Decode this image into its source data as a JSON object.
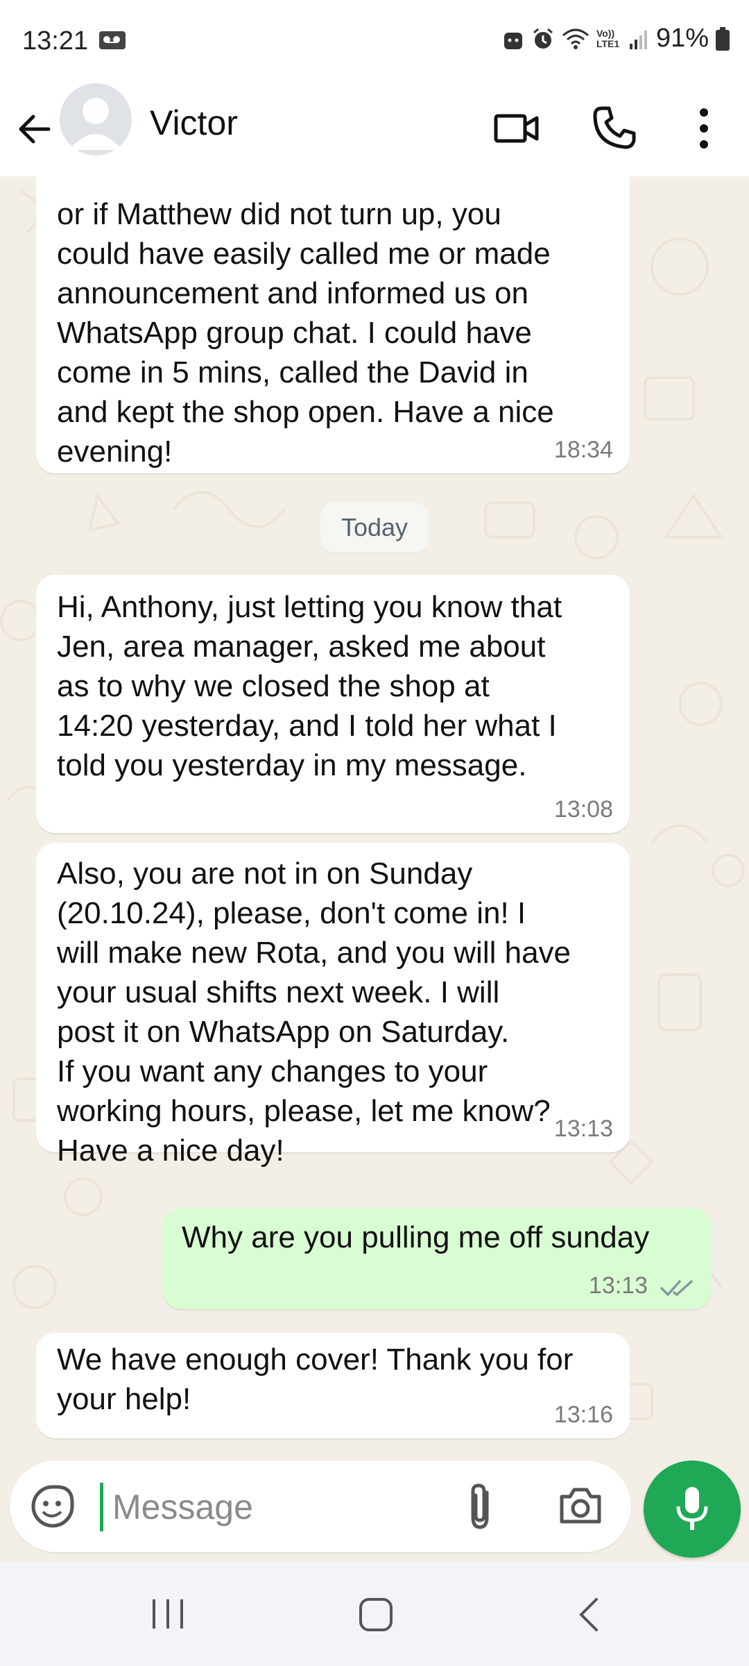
{
  "status_bar": {
    "time": "13:21",
    "signal_label": "Vo)) LTE1",
    "battery": "91%"
  },
  "header": {
    "contact_name": "Victor",
    "icons": [
      "back-arrow-icon",
      "avatar",
      "video-call-icon",
      "phone-call-icon",
      "more-options-icon"
    ]
  },
  "chat": {
    "date_separator": "Today",
    "messages": [
      {
        "direction": "in",
        "text": "or if Matthew did not turn up, you\ncould have easily called me or made\nannouncement and informed us on\nWhatsApp group chat. I could have\ncome in 5 mins, called the David in\nand kept the shop open. Have a nice\nevening!",
        "time": "18:34"
      },
      {
        "direction": "in",
        "text": "Hi, Anthony, just letting you know that\nJen, area manager, asked me about\nas to why we closed the shop at\n14:20 yesterday, and I told her what I\ntold you yesterday in my message.",
        "time": "13:08"
      },
      {
        "direction": "in",
        "text": "Also, you are not in on Sunday\n(20.10.24), please, don't come in! I\nwill make new Rota, and you will have\nyour usual shifts next week.  I will\npost it on WhatsApp on Saturday.\nIf you want any changes to your\nworking hours, please, let me know?\nHave a nice day!",
        "time": "13:13"
      },
      {
        "direction": "out",
        "text": "Why are you pulling me off sunday",
        "time": "13:13",
        "status": "delivered"
      },
      {
        "direction": "in",
        "text": "We have enough cover! Thank you for\nyour help!",
        "time": "13:16"
      }
    ]
  },
  "composer": {
    "placeholder": "Message"
  },
  "colors": {
    "accent": "#1fa855",
    "outgoing_bubble": "#d9fdd3",
    "incoming_bubble": "#ffffff",
    "chat_background": "#f4efe6"
  }
}
